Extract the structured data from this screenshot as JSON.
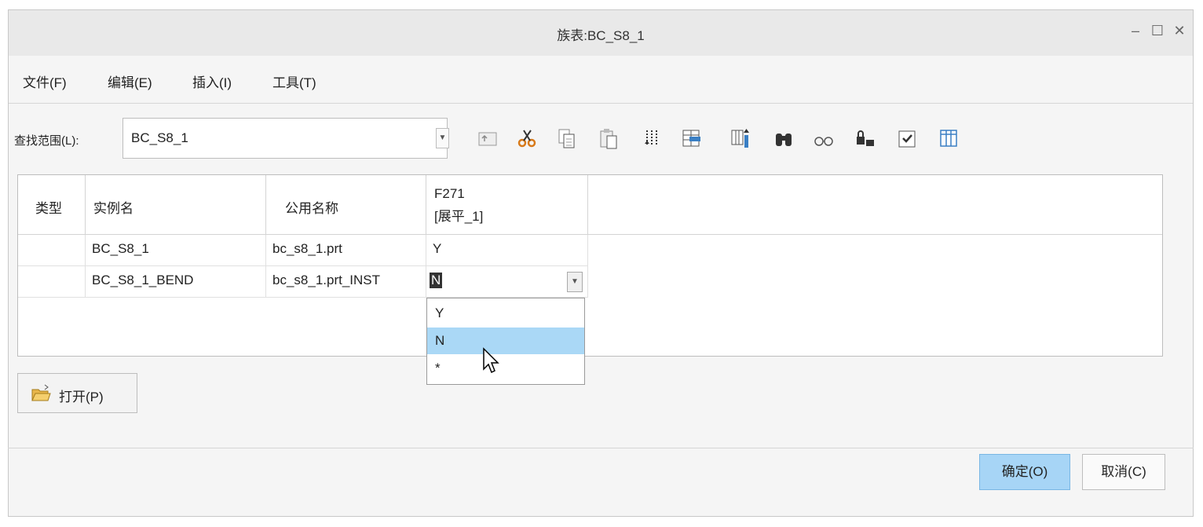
{
  "window": {
    "title": "族表:BC_S8_1",
    "controls": {
      "minimize": "–",
      "maximize": "☐",
      "close": "✕"
    }
  },
  "menu": [
    {
      "label": "文件(F)"
    },
    {
      "label": "编辑(E)"
    },
    {
      "label": "插入(I)"
    },
    {
      "label": "工具(T)"
    }
  ],
  "search": {
    "label": "查找范围(L):",
    "value": "BC_S8_1"
  },
  "toolbar_icons": [
    "folder-up-icon",
    "cut-icon",
    "copy-icon",
    "paste-icon",
    "insert-rows-icon",
    "insert-columns-icon",
    "column-insert-icon",
    "find-icon",
    "preview-icon",
    "lock-icon",
    "verify-icon",
    "table-icon"
  ],
  "table": {
    "headers": {
      "type": "类型",
      "instance": "实例名",
      "common_name": "公用名称",
      "f271_line1": "F271",
      "f271_line2": "[展平_1]"
    },
    "rows": [
      {
        "type": "",
        "instance": "BC_S8_1",
        "common_name": "bc_s8_1.prt",
        "f271": "Y"
      },
      {
        "type": "",
        "instance": "BC_S8_1_BEND",
        "common_name": "bc_s8_1.prt_INST",
        "f271": "N"
      }
    ]
  },
  "dropdown": {
    "options": [
      "Y",
      "N",
      "*"
    ],
    "selected": "N"
  },
  "open_button": {
    "label": "打开(P)"
  },
  "footer": {
    "ok": "确定(O)",
    "cancel": "取消(C)"
  },
  "colors": {
    "accent": "#a7d5f6",
    "selection": "#aad8f6",
    "icon_blue": "#3a7fc4"
  }
}
